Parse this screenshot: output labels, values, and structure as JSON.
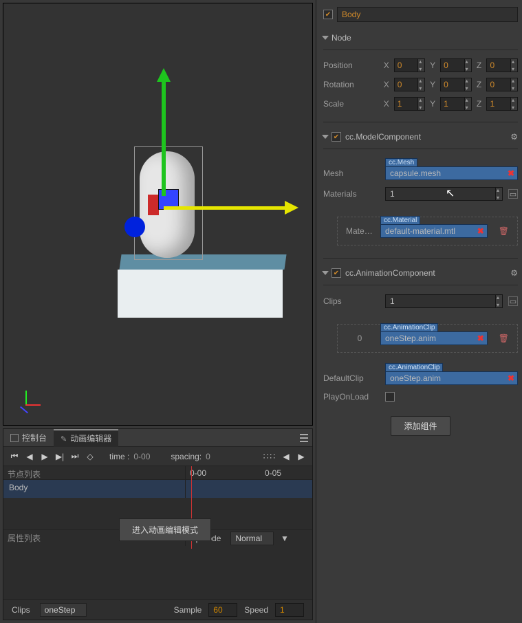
{
  "header": {
    "node_name": "Body",
    "enabled": true
  },
  "node": {
    "title": "Node",
    "position": {
      "label": "Position",
      "x": "0",
      "y": "0",
      "z": "0"
    },
    "rotation": {
      "label": "Rotation",
      "x": "0",
      "y": "0",
      "z": "0"
    },
    "scale": {
      "label": "Scale",
      "x": "1",
      "y": "1",
      "z": "1"
    },
    "axis": {
      "x": "X",
      "y": "Y",
      "z": "Z"
    }
  },
  "model": {
    "title": "cc.ModelComponent",
    "enabled": true,
    "mesh": {
      "label": "Mesh",
      "type": "cc.Mesh",
      "value": "capsule.mesh"
    },
    "materials": {
      "label": "Materials",
      "count": "1",
      "items": [
        {
          "index_label": "Mater…",
          "type": "cc.Material",
          "value": "default-material.mtl"
        }
      ]
    }
  },
  "animation": {
    "title": "cc.AnimationComponent",
    "enabled": true,
    "clips": {
      "label": "Clips",
      "count": "1",
      "items": [
        {
          "index_label": "0",
          "type": "cc.AnimationClip",
          "value": "oneStep.anim"
        }
      ]
    },
    "default_clip": {
      "label": "DefaultClip",
      "type": "cc.AnimationClip",
      "value": "oneStep.anim"
    },
    "play_on_load": {
      "label": "PlayOnLoad",
      "value": false
    }
  },
  "add_component": "添加组件",
  "tabs": {
    "console": "控制台",
    "anim_editor": "动画编辑器"
  },
  "timeline": {
    "time_label": "time :",
    "time_value": "0-00",
    "spacing_label": "spacing:",
    "spacing_value": "0",
    "node_list": "节点列表",
    "ruler": {
      "t0": "0-00",
      "t1": "0-05"
    },
    "selected_node": "Body",
    "prop_list": "属性列表",
    "wrap_label": "upMode",
    "wrap_value": "Normal",
    "enter_button": "进入动画编辑模式",
    "footer": {
      "clips_label": "Clips",
      "clips_value": "oneStep",
      "sample_label": "Sample",
      "sample_value": "60",
      "speed_label": "Speed",
      "speed_value": "1"
    }
  }
}
